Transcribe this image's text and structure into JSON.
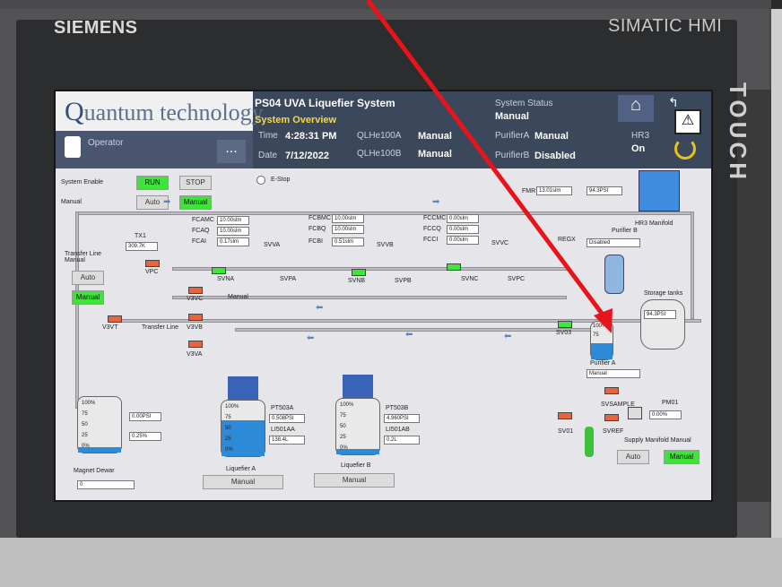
{
  "bezel": {
    "brand": "SIEMENS",
    "model": "SIMATIC HMI",
    "side_label": "TOUCH"
  },
  "header": {
    "logo_text": "uantum technology",
    "logo_q": "Q",
    "title": "PS04 UVA Liquefier System",
    "subtitle": "System Overview",
    "operator": "Operator",
    "time_label": "Time",
    "time": "4:28:31 PM",
    "date_label": "Date",
    "date": "7/12/2022",
    "qlhe100a": "QLHe100A",
    "qlhe100a_mode": "Manual",
    "qlhe100b": "QLHe100B",
    "qlhe100b_mode": "Manual",
    "status_label": "System Status",
    "status": "Manual",
    "purifier_a_label": "PurifierA",
    "purifier_a": "Manual",
    "purifier_b_label": "PurifierB",
    "purifier_b": "Disabled",
    "hr3_label": "HR3",
    "hr3": "On",
    "dots": "..."
  },
  "controls": {
    "system_enable": "System Enable",
    "run": "RUN",
    "stop": "STOP",
    "estop": "E-Stop",
    "manual_label": "Manual",
    "auto": "Auto",
    "manual": "Manual"
  },
  "flow": {
    "fcamc": "FCAMC",
    "fcamc_val": "10.00slm",
    "fcaq": "FCAQ",
    "fcaq_val": "10.00slm",
    "fcai": "FCAI",
    "fcai_val": "0.17slm",
    "fcbmc": "FCBMC",
    "fcbmc_val": "10.00slm",
    "fcbq": "FCBQ",
    "fcbq_val": "10.00slm",
    "fcbi": "FCBI",
    "fcbi_val": "0.51slm",
    "fccmc": "FCCMC",
    "fccmc_val": "0.00slm",
    "fccq": "FCCQ",
    "fccq_val": "0.00slm",
    "fcci": "FCCI",
    "fcci_val": "0.00slm",
    "fmr": "FMR",
    "fmr_val": "13.01slm",
    "psi_top": "94.3PSI"
  },
  "valves": {
    "svva": "SVVA",
    "svna": "SVNA",
    "svpa": "SVPA",
    "svvb": "SVVB",
    "svnb": "SVNB",
    "svpb": "SVPB",
    "svvc": "SVVC",
    "svnc": "SVNC",
    "svpc": "SVPC",
    "vpc": "VPC",
    "v3vc": "V3VC",
    "v3vb": "V3VB",
    "v3va": "V3VA",
    "v3vt": "V3VT",
    "sv03": "SV03",
    "sv01": "SV01",
    "svsampl": "SVSAMPLE",
    "svref": "SVREF",
    "regx": "REGX",
    "manual_tag": "Manual"
  },
  "labels": {
    "tx1": "TX1",
    "tx1_val": "309.7K",
    "transfer_line": "Transfer Line",
    "transfer_line_manual": "Transfer Line\nManual",
    "tl_auto": "Auto",
    "tl_manual": "Manual",
    "hr3_manifold": "HR3 Manifold",
    "purifier_b": "Purifier B",
    "purifier_b_state": "Disabled",
    "purifier_a": "Purifier A",
    "purifier_a_state": "Manual",
    "storage_tanks": "Storage tanks",
    "storage_psi": "94.3PSI",
    "pm01": "PM01",
    "pm01_val": "0.00%",
    "supply_manifold": "Supply Manifold Manual",
    "sm_auto": "Auto",
    "sm_manual": "Manual"
  },
  "tanks": {
    "magnet": {
      "name": "Magnet Dewar",
      "psi": "0.00PSI",
      "pct": "0.25%",
      "levels": [
        "100%",
        "75",
        "50",
        "25",
        "0%"
      ],
      "footer": "0"
    },
    "liq_a": {
      "name": "Liquefier A",
      "pt": "PT503A",
      "pt_val": "0.508PSI",
      "li": "LI501AA",
      "li_val": "138.4L",
      "levels": [
        "100%",
        "75",
        "50",
        "25",
        "0%"
      ],
      "mode": "Manual"
    },
    "liq_b": {
      "name": "Liquefier B",
      "pt": "PT503B",
      "pt_val": "4.960PSI",
      "li": "LI501AB",
      "li_val": "0.2L",
      "levels": [
        "100%",
        "75",
        "50",
        "25",
        "0%"
      ],
      "mode": "Manual"
    },
    "purifier_a_levels": [
      "100%",
      "75"
    ]
  }
}
